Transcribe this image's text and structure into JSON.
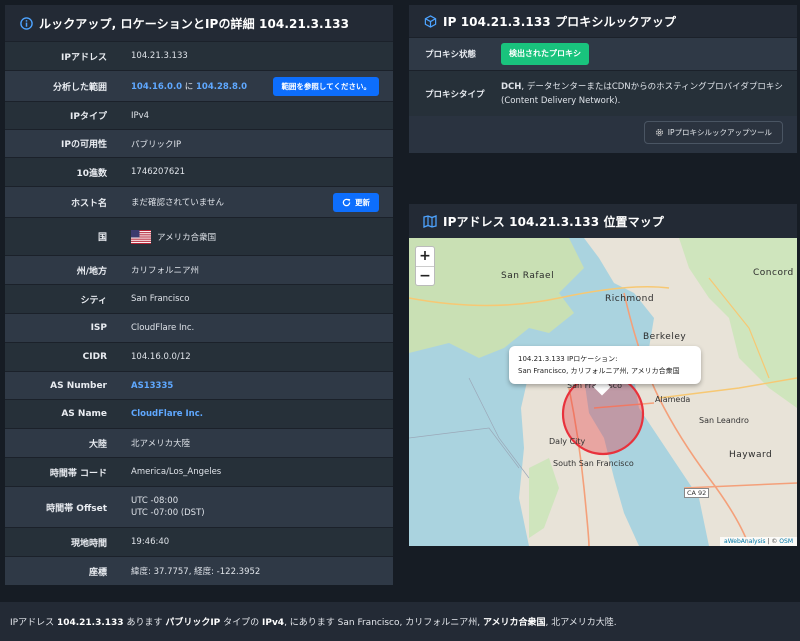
{
  "left_panel": {
    "title": "ルックアップ, ロケーションとIPの詳細 104.21.3.133",
    "rows": {
      "ip": {
        "label": "IPアドレス",
        "value": "104.21.3.133"
      },
      "range": {
        "label": "分析した範囲",
        "from": "104.16.0.0",
        "sep": " に ",
        "to": "104.28.8.0",
        "button": "範囲を参照してください。"
      },
      "iptype": {
        "label": "IPタイプ",
        "value": "IPv4"
      },
      "avail": {
        "label": "IPの可用性",
        "value": "パブリックIP"
      },
      "decimal": {
        "label": "10進数",
        "value": "1746207621"
      },
      "host": {
        "label": "ホスト名",
        "value": "まだ確認されていません",
        "button": "更新"
      },
      "country": {
        "label": "国",
        "value": "アメリカ合衆国"
      },
      "state": {
        "label": "州/地方",
        "value": "カリフォルニア州"
      },
      "city": {
        "label": "シティ",
        "value": "San Francisco"
      },
      "isp": {
        "label": "ISP",
        "value": "CloudFlare Inc."
      },
      "cidr": {
        "label": "CIDR",
        "value": "104.16.0.0/12"
      },
      "asn": {
        "label": "AS Number",
        "value": "AS13335"
      },
      "asname": {
        "label": "AS Name",
        "value": "CloudFlare Inc."
      },
      "continent": {
        "label": "大陸",
        "value": "北アメリカ大陸"
      },
      "tz": {
        "label": "時間帯 コード",
        "value": "America/Los_Angeles"
      },
      "offset": {
        "label": "時間帯 Offset",
        "line1": "UTC -08:00",
        "line2": "UTC -07:00 (DST)"
      },
      "localtime": {
        "label": "現地時間",
        "value": "19:46:40"
      },
      "coords": {
        "label": "座標",
        "value": "緯度: 37.7757, 経度: -122.3952"
      }
    }
  },
  "proxy_panel": {
    "title": "IP 104.21.3.133 プロキシルックアップ",
    "status_label": "プロキシ状態",
    "status_value": "検出されたプロキシ",
    "type_label": "プロキシタイプ",
    "type_code": "DCH",
    "type_value": ", データセンターまたはCDNからのホスティングプロバイダプロキシ (Content Delivery Network).",
    "tool_button": "IPプロキシルックアップツール"
  },
  "map_panel": {
    "title": "IPアドレス 104.21.3.133 位置マップ",
    "zoom_in": "+",
    "zoom_out": "−",
    "popup_line1": "104.21.3.133 IPロケーション:",
    "popup_line2": "San Francisco, カリフォルニア州, アメリカ合衆国",
    "attribution_link": "aWebAnalysis",
    "attribution_sep": " | © ",
    "attribution_osm": "OSM",
    "labels": {
      "san_rafael": "San Rafael",
      "richmond": "Richmond",
      "berkeley": "Berkeley",
      "concord": "Concord",
      "alameda": "Alameda",
      "san_leandro": "San Leandro",
      "hayward": "Hayward",
      "daly_city": "Daly City",
      "south_sf": "South San Francisco",
      "sf": "San Francisco",
      "ca92": "CA 92"
    }
  },
  "footer": {
    "p1": "IPアドレス ",
    "ip": "104.21.3.133",
    "p2": " あります ",
    "avail": "パブリックIP",
    "p3": " タイプの ",
    "type": "IPv4",
    "p4": ", にあります San Francisco, カリフォルニア州, ",
    "country": "アメリカ合衆国",
    "p5": ", 北アメリカ大陸."
  },
  "colors": {
    "accent_blue": "#0d6efd",
    "badge_green": "#19c37d",
    "link": "#5fa8ff",
    "circle": "#e8323c"
  }
}
